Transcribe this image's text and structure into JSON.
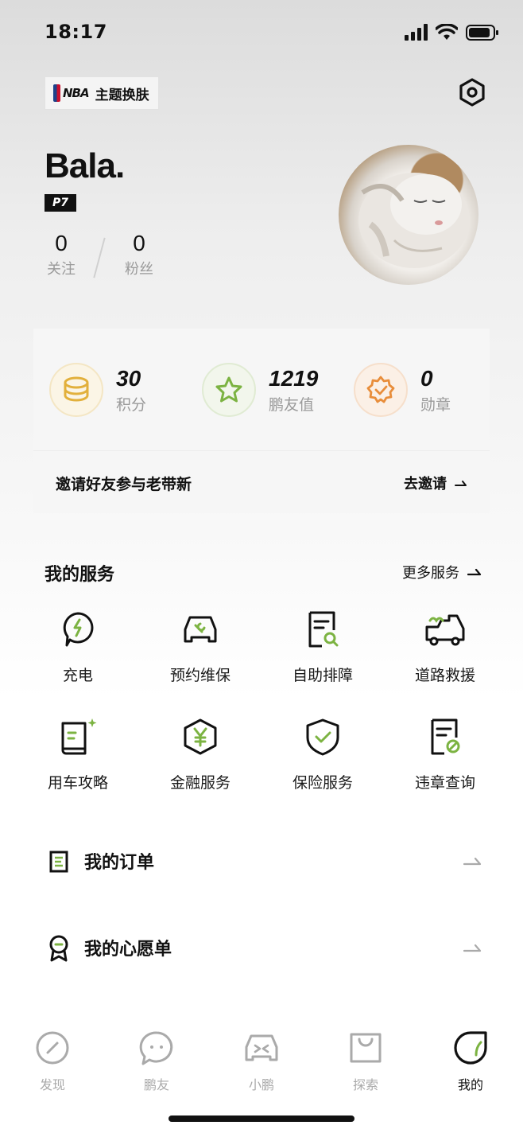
{
  "status_bar": {
    "time": "18:17"
  },
  "header": {
    "theme_button_label": "主题换肤",
    "theme_logo_text": "NBA"
  },
  "profile": {
    "username": "Bala.",
    "model": "P7",
    "following_count": "0",
    "following_label": "关注",
    "followers_count": "0",
    "followers_label": "粉丝"
  },
  "points_card": {
    "items": [
      {
        "value": "30",
        "label": "积分",
        "icon": "coins-icon"
      },
      {
        "value": "1219",
        "label": "鹏友值",
        "icon": "star-icon"
      },
      {
        "value": "0",
        "label": "勋章",
        "icon": "medal-icon"
      }
    ],
    "invite_text": "邀请好友参与老带新",
    "invite_button": "去邀请"
  },
  "services": {
    "title": "我的服务",
    "more_label": "更多服务",
    "items": [
      {
        "label": "充电",
        "icon": "charging-icon"
      },
      {
        "label": "预约维保",
        "icon": "car-repair-icon"
      },
      {
        "label": "自助排障",
        "icon": "diagnose-icon"
      },
      {
        "label": "道路救援",
        "icon": "tow-truck-icon"
      },
      {
        "label": "用车攻略",
        "icon": "guide-book-icon"
      },
      {
        "label": "金融服务",
        "icon": "finance-icon"
      },
      {
        "label": "保险服务",
        "icon": "insurance-shield-icon"
      },
      {
        "label": "违章查询",
        "icon": "violation-query-icon"
      }
    ]
  },
  "list": {
    "orders_label": "我的订单",
    "wishlist_label": "我的心愿单"
  },
  "tab_bar": {
    "items": [
      {
        "label": "发现",
        "icon": "discover-icon"
      },
      {
        "label": "鹏友",
        "icon": "chat-icon"
      },
      {
        "label": "小鹏",
        "icon": "car-icon"
      },
      {
        "label": "探索",
        "icon": "shopping-bag-icon"
      },
      {
        "label": "我的",
        "icon": "profile-leaf-icon"
      }
    ],
    "active_index": 4
  },
  "colors": {
    "accent_green": "#7cb342",
    "gold": "#e2b03c",
    "orange": "#e88d3a"
  }
}
